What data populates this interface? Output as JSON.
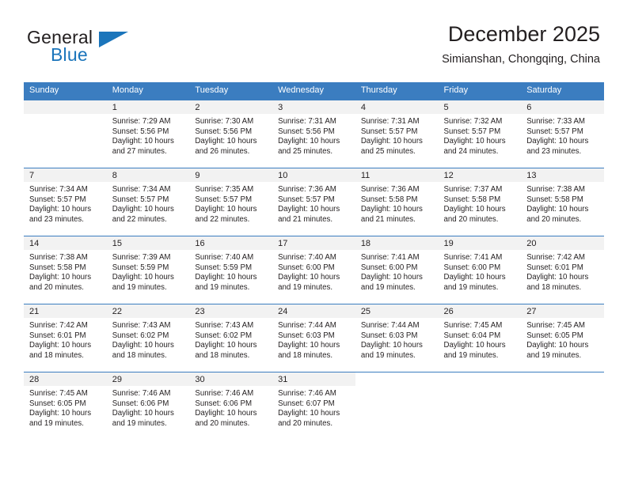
{
  "brand": {
    "name_top": "General",
    "name_bottom": "Blue",
    "logo_icon": "triangle-logo-icon"
  },
  "header": {
    "title": "December 2025",
    "subtitle": "Simianshan, Chongqing, China"
  },
  "theme": {
    "header_blue": "#3b7dc0",
    "brand_blue": "#1b75bb",
    "daynum_band": "#f2f2f2",
    "text": "#231f20"
  },
  "calendar": {
    "weekday_headers": [
      "Sunday",
      "Monday",
      "Tuesday",
      "Wednesday",
      "Thursday",
      "Friday",
      "Saturday"
    ],
    "labels": {
      "sunrise": "Sunrise:",
      "sunset": "Sunset:",
      "daylight": "Daylight:"
    },
    "weeks": [
      [
        {
          "day": "",
          "empty": true
        },
        {
          "day": "1",
          "sunrise": "Sunrise: 7:29 AM",
          "sunset": "Sunset: 5:56 PM",
          "daylight1": "Daylight: 10 hours",
          "daylight2": "and 27 minutes."
        },
        {
          "day": "2",
          "sunrise": "Sunrise: 7:30 AM",
          "sunset": "Sunset: 5:56 PM",
          "daylight1": "Daylight: 10 hours",
          "daylight2": "and 26 minutes."
        },
        {
          "day": "3",
          "sunrise": "Sunrise: 7:31 AM",
          "sunset": "Sunset: 5:56 PM",
          "daylight1": "Daylight: 10 hours",
          "daylight2": "and 25 minutes."
        },
        {
          "day": "4",
          "sunrise": "Sunrise: 7:31 AM",
          "sunset": "Sunset: 5:57 PM",
          "daylight1": "Daylight: 10 hours",
          "daylight2": "and 25 minutes."
        },
        {
          "day": "5",
          "sunrise": "Sunrise: 7:32 AM",
          "sunset": "Sunset: 5:57 PM",
          "daylight1": "Daylight: 10 hours",
          "daylight2": "and 24 minutes."
        },
        {
          "day": "6",
          "sunrise": "Sunrise: 7:33 AM",
          "sunset": "Sunset: 5:57 PM",
          "daylight1": "Daylight: 10 hours",
          "daylight2": "and 23 minutes."
        }
      ],
      [
        {
          "day": "7",
          "sunrise": "Sunrise: 7:34 AM",
          "sunset": "Sunset: 5:57 PM",
          "daylight1": "Daylight: 10 hours",
          "daylight2": "and 23 minutes."
        },
        {
          "day": "8",
          "sunrise": "Sunrise: 7:34 AM",
          "sunset": "Sunset: 5:57 PM",
          "daylight1": "Daylight: 10 hours",
          "daylight2": "and 22 minutes."
        },
        {
          "day": "9",
          "sunrise": "Sunrise: 7:35 AM",
          "sunset": "Sunset: 5:57 PM",
          "daylight1": "Daylight: 10 hours",
          "daylight2": "and 22 minutes."
        },
        {
          "day": "10",
          "sunrise": "Sunrise: 7:36 AM",
          "sunset": "Sunset: 5:57 PM",
          "daylight1": "Daylight: 10 hours",
          "daylight2": "and 21 minutes."
        },
        {
          "day": "11",
          "sunrise": "Sunrise: 7:36 AM",
          "sunset": "Sunset: 5:58 PM",
          "daylight1": "Daylight: 10 hours",
          "daylight2": "and 21 minutes."
        },
        {
          "day": "12",
          "sunrise": "Sunrise: 7:37 AM",
          "sunset": "Sunset: 5:58 PM",
          "daylight1": "Daylight: 10 hours",
          "daylight2": "and 20 minutes."
        },
        {
          "day": "13",
          "sunrise": "Sunrise: 7:38 AM",
          "sunset": "Sunset: 5:58 PM",
          "daylight1": "Daylight: 10 hours",
          "daylight2": "and 20 minutes."
        }
      ],
      [
        {
          "day": "14",
          "sunrise": "Sunrise: 7:38 AM",
          "sunset": "Sunset: 5:58 PM",
          "daylight1": "Daylight: 10 hours",
          "daylight2": "and 20 minutes."
        },
        {
          "day": "15",
          "sunrise": "Sunrise: 7:39 AM",
          "sunset": "Sunset: 5:59 PM",
          "daylight1": "Daylight: 10 hours",
          "daylight2": "and 19 minutes."
        },
        {
          "day": "16",
          "sunrise": "Sunrise: 7:40 AM",
          "sunset": "Sunset: 5:59 PM",
          "daylight1": "Daylight: 10 hours",
          "daylight2": "and 19 minutes."
        },
        {
          "day": "17",
          "sunrise": "Sunrise: 7:40 AM",
          "sunset": "Sunset: 6:00 PM",
          "daylight1": "Daylight: 10 hours",
          "daylight2": "and 19 minutes."
        },
        {
          "day": "18",
          "sunrise": "Sunrise: 7:41 AM",
          "sunset": "Sunset: 6:00 PM",
          "daylight1": "Daylight: 10 hours",
          "daylight2": "and 19 minutes."
        },
        {
          "day": "19",
          "sunrise": "Sunrise: 7:41 AM",
          "sunset": "Sunset: 6:00 PM",
          "daylight1": "Daylight: 10 hours",
          "daylight2": "and 19 minutes."
        },
        {
          "day": "20",
          "sunrise": "Sunrise: 7:42 AM",
          "sunset": "Sunset: 6:01 PM",
          "daylight1": "Daylight: 10 hours",
          "daylight2": "and 18 minutes."
        }
      ],
      [
        {
          "day": "21",
          "sunrise": "Sunrise: 7:42 AM",
          "sunset": "Sunset: 6:01 PM",
          "daylight1": "Daylight: 10 hours",
          "daylight2": "and 18 minutes."
        },
        {
          "day": "22",
          "sunrise": "Sunrise: 7:43 AM",
          "sunset": "Sunset: 6:02 PM",
          "daylight1": "Daylight: 10 hours",
          "daylight2": "and 18 minutes."
        },
        {
          "day": "23",
          "sunrise": "Sunrise: 7:43 AM",
          "sunset": "Sunset: 6:02 PM",
          "daylight1": "Daylight: 10 hours",
          "daylight2": "and 18 minutes."
        },
        {
          "day": "24",
          "sunrise": "Sunrise: 7:44 AM",
          "sunset": "Sunset: 6:03 PM",
          "daylight1": "Daylight: 10 hours",
          "daylight2": "and 18 minutes."
        },
        {
          "day": "25",
          "sunrise": "Sunrise: 7:44 AM",
          "sunset": "Sunset: 6:03 PM",
          "daylight1": "Daylight: 10 hours",
          "daylight2": "and 19 minutes."
        },
        {
          "day": "26",
          "sunrise": "Sunrise: 7:45 AM",
          "sunset": "Sunset: 6:04 PM",
          "daylight1": "Daylight: 10 hours",
          "daylight2": "and 19 minutes."
        },
        {
          "day": "27",
          "sunrise": "Sunrise: 7:45 AM",
          "sunset": "Sunset: 6:05 PM",
          "daylight1": "Daylight: 10 hours",
          "daylight2": "and 19 minutes."
        }
      ],
      [
        {
          "day": "28",
          "sunrise": "Sunrise: 7:45 AM",
          "sunset": "Sunset: 6:05 PM",
          "daylight1": "Daylight: 10 hours",
          "daylight2": "and 19 minutes."
        },
        {
          "day": "29",
          "sunrise": "Sunrise: 7:46 AM",
          "sunset": "Sunset: 6:06 PM",
          "daylight1": "Daylight: 10 hours",
          "daylight2": "and 19 minutes."
        },
        {
          "day": "30",
          "sunrise": "Sunrise: 7:46 AM",
          "sunset": "Sunset: 6:06 PM",
          "daylight1": "Daylight: 10 hours",
          "daylight2": "and 20 minutes."
        },
        {
          "day": "31",
          "sunrise": "Sunrise: 7:46 AM",
          "sunset": "Sunset: 6:07 PM",
          "daylight1": "Daylight: 10 hours",
          "daylight2": "and 20 minutes."
        },
        {
          "day": "",
          "blank": true
        },
        {
          "day": "",
          "blank": true
        },
        {
          "day": "",
          "blank": true
        }
      ]
    ]
  }
}
